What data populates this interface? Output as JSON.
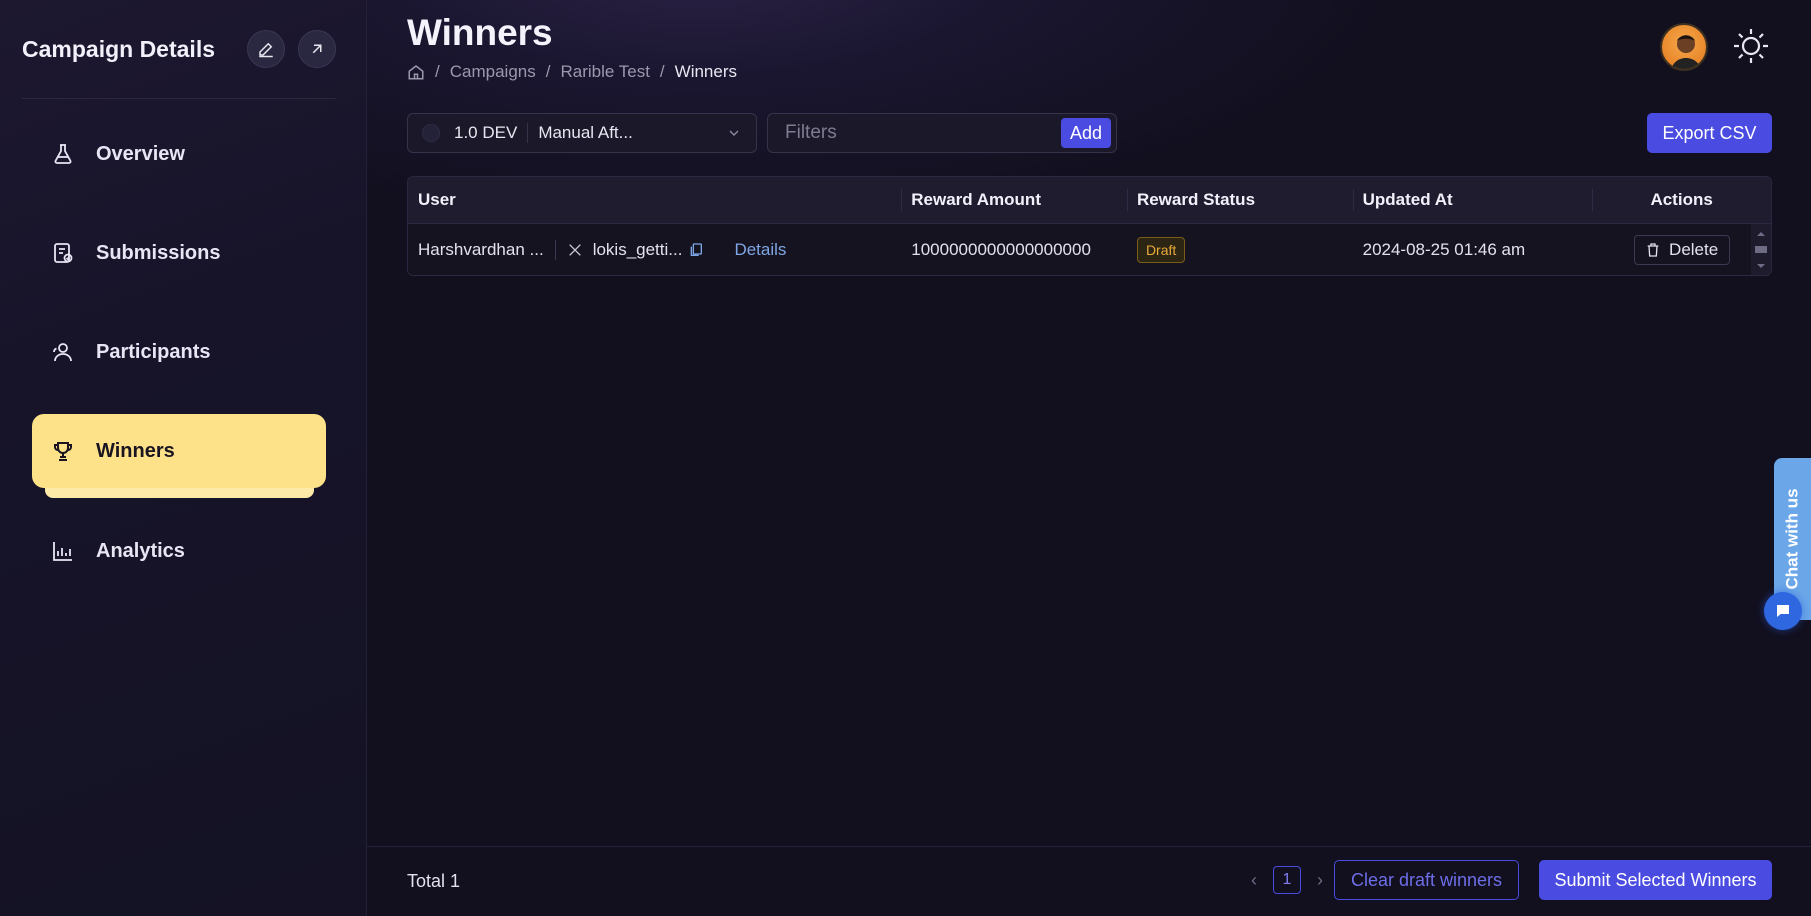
{
  "sidebar": {
    "title": "Campaign Details",
    "items": [
      {
        "label": "Overview",
        "icon": "flask-icon"
      },
      {
        "label": "Submissions",
        "icon": "clipboard-check-icon"
      },
      {
        "label": "Participants",
        "icon": "users-icon"
      },
      {
        "label": "Winners",
        "icon": "trophy-icon",
        "active": true
      },
      {
        "label": "Analytics",
        "icon": "bar-chart-icon"
      }
    ]
  },
  "header": {
    "title": "Winners",
    "breadcrumb": [
      "Campaigns",
      "Rarible Test",
      "Winners"
    ]
  },
  "toolbar": {
    "version": "1.0 DEV",
    "mode": "Manual Aft...",
    "filters_placeholder": "Filters",
    "add_label": "Add",
    "export_label": "Export CSV"
  },
  "table": {
    "columns": [
      "User",
      "Reward Amount",
      "Reward Status",
      "Updated At",
      "Actions"
    ],
    "rows": [
      {
        "user": "Harshvardhan ...",
        "handle": "lokis_getti...",
        "details": "Details",
        "amount": "1000000000000000000",
        "status": "Draft",
        "updated": "2024-08-25 01:46 am",
        "action": "Delete"
      }
    ]
  },
  "footer": {
    "total": "Total 1",
    "page": "1",
    "clear_label": "Clear draft winners",
    "submit_label": "Submit Selected Winners"
  },
  "chat": {
    "label": "Chat with us"
  },
  "colors": {
    "accent": "#4a4be0",
    "active_nav": "#fde28a",
    "draft": "#e8a83a",
    "link": "#7fa6e6"
  }
}
